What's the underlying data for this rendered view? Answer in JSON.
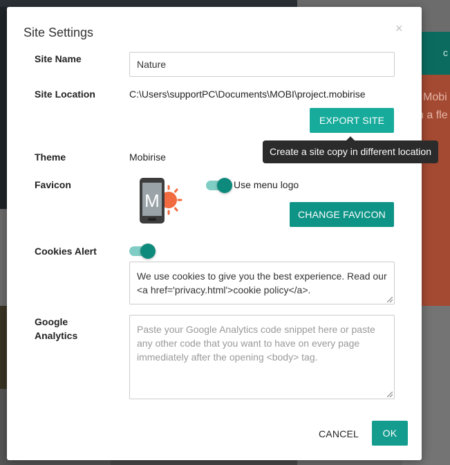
{
  "background": {
    "teal_letter": "c",
    "orange_line1": "Mobi",
    "orange_line2": "h a fle"
  },
  "dialog": {
    "title": "Site Settings",
    "close_glyph": "×",
    "site_name": {
      "label": "Site Name",
      "value": "Nature"
    },
    "site_location": {
      "label": "Site Location",
      "value": "C:\\Users\\supportPC\\Documents\\MOBI\\project.mobirise",
      "export_button": "EXPORT SITE",
      "tooltip": "Create a site copy in different location"
    },
    "theme": {
      "label": "Theme",
      "value": "Mobirise"
    },
    "favicon": {
      "label": "Favicon",
      "image_letter": "M",
      "use_menu_logo_label": "Use menu logo",
      "use_menu_logo_enabled": true,
      "change_button": "CHANGE FAVICON"
    },
    "cookies_alert": {
      "label": "Cookies Alert",
      "enabled": true,
      "text": "We use cookies to give you the best experience. Read our <a href='privacy.html'>cookie policy</a>."
    },
    "google_analytics": {
      "label": "Google Analytics",
      "value": "",
      "placeholder": "Paste your Google Analytics code snippet here or paste any other code that you want to have on every page immediately after the opening <body> tag."
    },
    "cancel_button": "CANCEL",
    "ok_button": "OK"
  },
  "colors": {
    "accent": "#149c8e",
    "toggle_track": "#7fcdc4",
    "toggle_knob": "#0e8a7d",
    "tooltip_bg": "#2b2b2b"
  }
}
